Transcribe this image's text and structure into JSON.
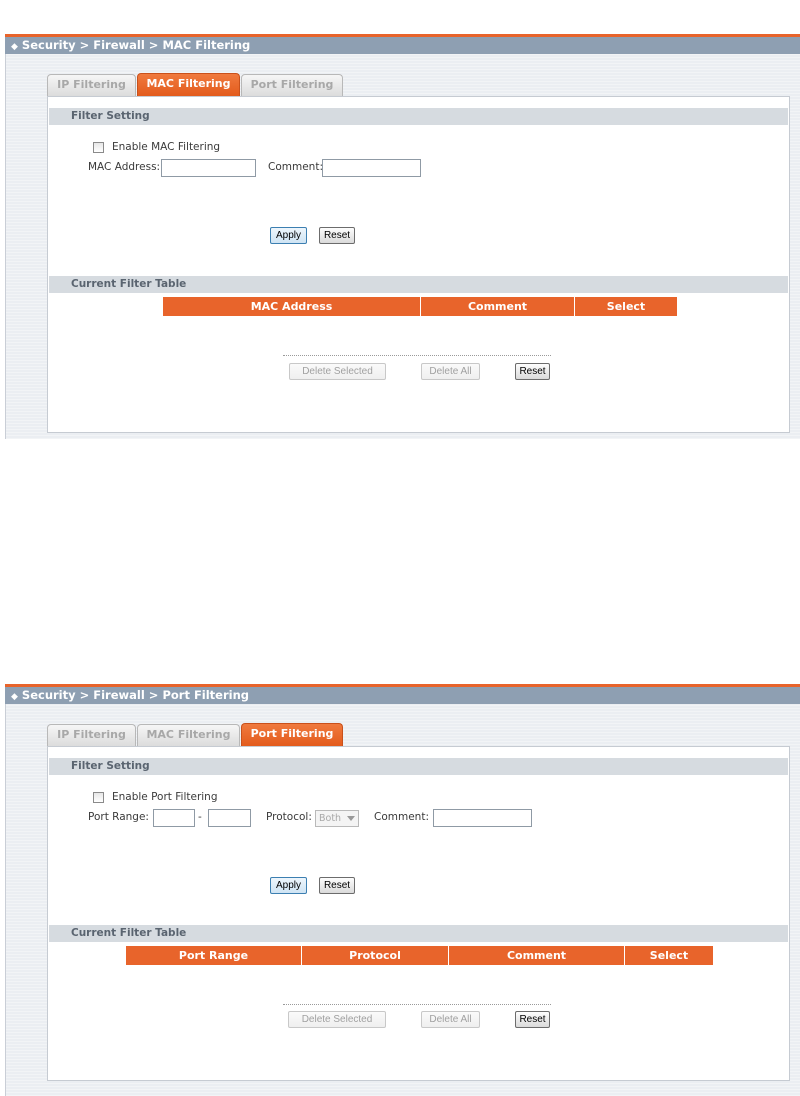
{
  "mac_panel": {
    "breadcrumb": "Security > Firewall > MAC Filtering",
    "tabs": [
      "IP Filtering",
      "MAC Filtering",
      "Port Filtering"
    ],
    "active_tab": "MAC Filtering",
    "filter_setting_title": "Filter Setting",
    "enable_label": "Enable MAC Filtering",
    "enable_checked": false,
    "mac_address_label": "MAC Address:",
    "mac_address_value": "",
    "comment_label": "Comment:",
    "comment_value": "",
    "apply_label": "Apply",
    "reset_label": "Reset",
    "table_title": "Current Filter Table",
    "columns": [
      "MAC Address",
      "Comment",
      "Select"
    ],
    "delete_selected_label": "Delete Selected",
    "delete_all_label": "Delete All",
    "table_reset_label": "Reset"
  },
  "port_panel": {
    "breadcrumb": "Security > Firewall > Port Filtering",
    "tabs": [
      "IP Filtering",
      "MAC Filtering",
      "Port Filtering"
    ],
    "active_tab": "Port Filtering",
    "filter_setting_title": "Filter Setting",
    "enable_label": "Enable Port Filtering",
    "enable_checked": false,
    "port_range_label": "Port Range:",
    "port_range_sep": "-",
    "port_from_value": "",
    "port_to_value": "",
    "protocol_label": "Protocol:",
    "protocol_selected": "Both",
    "comment_label": "Comment:",
    "comment_value": "",
    "apply_label": "Apply",
    "reset_label": "Reset",
    "table_title": "Current Filter Table",
    "columns": [
      "Port Range",
      "Protocol",
      "Comment",
      "Select"
    ],
    "delete_selected_label": "Delete Selected",
    "delete_all_label": "Delete All",
    "table_reset_label": "Reset"
  },
  "colors": {
    "accent": "#e8642b",
    "titlebar": "#8e9fb2",
    "section_header": "#d6dbe0"
  },
  "icons": {
    "breadcrumb_bullet": "diamond-icon",
    "dropdown_arrow": "chevron-down-icon"
  }
}
